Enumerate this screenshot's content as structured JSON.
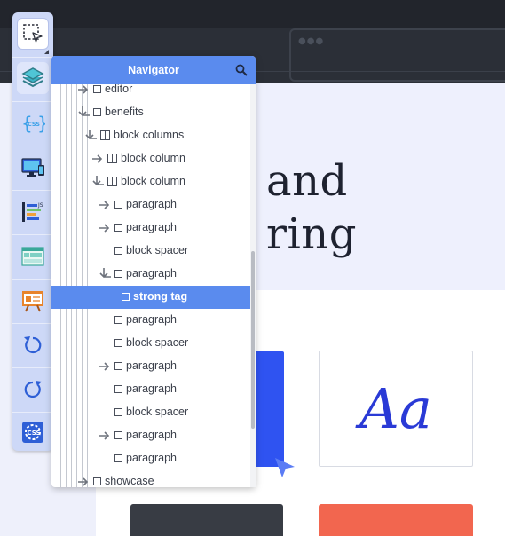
{
  "colors": {
    "topbar": "#22252c",
    "accent": "#5a8bee",
    "toolbar_bg": "#cdd8f7",
    "brand_blue": "#2f53f1",
    "coral": "#f2664f",
    "dark_card": "#383c44"
  },
  "preview": {
    "hero_line1": "and",
    "hero_line2": "ring",
    "type_specimen": "Aa"
  },
  "toolbar": {
    "tools": [
      {
        "name": "select-element",
        "icon": "select-dashed-cursor-icon",
        "state": "active"
      },
      {
        "name": "layers",
        "icon": "layers-icon",
        "state": "pressed"
      },
      {
        "name": "css",
        "icon": "css-braces-icon",
        "state": "normal"
      },
      {
        "name": "responsive",
        "icon": "devices-icon",
        "state": "normal"
      },
      {
        "name": "components",
        "icon": "components-list-icon",
        "state": "normal"
      },
      {
        "name": "layout",
        "icon": "layout-grid-icon",
        "state": "normal"
      },
      {
        "name": "presentation",
        "icon": "presentation-board-icon",
        "state": "normal"
      },
      {
        "name": "undo",
        "icon": "undo-icon",
        "state": "normal"
      },
      {
        "name": "redo",
        "icon": "redo-icon",
        "state": "normal"
      },
      {
        "name": "css-settings",
        "icon": "css-gear-icon",
        "state": "normal"
      }
    ]
  },
  "navigator": {
    "title": "Navigator",
    "search_icon": "search-icon",
    "rows": [
      {
        "label": "editor",
        "icon": "box",
        "arrow": "right"
      },
      {
        "label": "benefits",
        "icon": "box",
        "arrow": "down"
      },
      {
        "label": "block columns",
        "icon": "columns",
        "arrow": "down"
      },
      {
        "label": "block column",
        "icon": "columns",
        "arrow": "right"
      },
      {
        "label": "block column",
        "icon": "columns",
        "arrow": "down"
      },
      {
        "label": "paragraph",
        "icon": "box",
        "arrow": "right"
      },
      {
        "label": "paragraph",
        "icon": "box",
        "arrow": "right"
      },
      {
        "label": "block spacer",
        "icon": "box",
        "arrow": "none"
      },
      {
        "label": "paragraph",
        "icon": "box",
        "arrow": "down"
      },
      {
        "label": "strong tag",
        "icon": "box",
        "arrow": "none",
        "selected": true
      },
      {
        "label": "paragraph",
        "icon": "box",
        "arrow": "none"
      },
      {
        "label": "block spacer",
        "icon": "box",
        "arrow": "none"
      },
      {
        "label": "paragraph",
        "icon": "box",
        "arrow": "right"
      },
      {
        "label": "paragraph",
        "icon": "box",
        "arrow": "none"
      },
      {
        "label": "block spacer",
        "icon": "box",
        "arrow": "none"
      },
      {
        "label": "paragraph",
        "icon": "box",
        "arrow": "right"
      },
      {
        "label": "paragraph",
        "icon": "box",
        "arrow": "none"
      },
      {
        "label": "showcase",
        "icon": "box",
        "arrow": "right"
      }
    ]
  }
}
